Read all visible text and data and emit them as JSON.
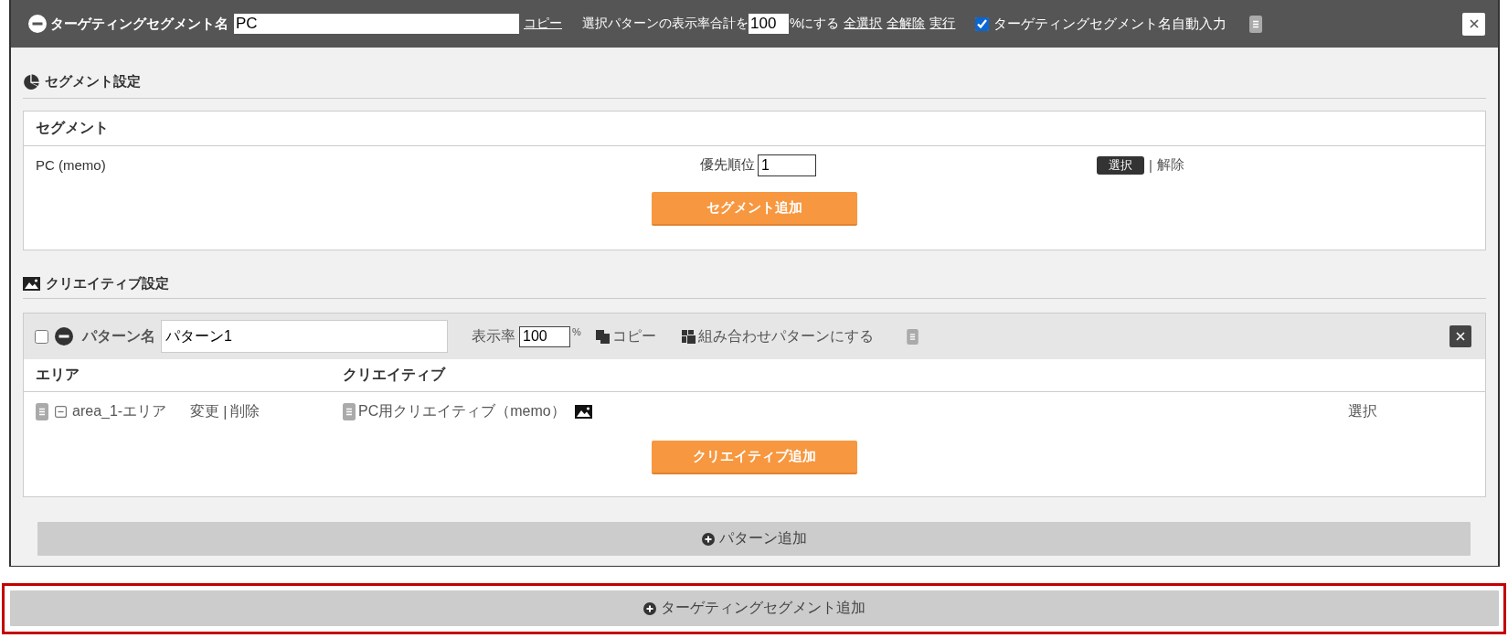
{
  "top_bar": {
    "title": "ターゲティングセグメント名",
    "segment_name": "PC",
    "copy_link": "コピー",
    "rate_prefix": "選択パターンの表示率合計を",
    "rate_value": "100",
    "rate_suffix": "%にする",
    "links": [
      "全選択",
      "全解除",
      "実行"
    ],
    "auto_name": {
      "label": "ターゲティングセグメント名自動入力",
      "checked": true
    }
  },
  "segment_settings": {
    "title": "セグメント設定",
    "table_title": "セグメント",
    "rows": [
      {
        "name": "PC (memo)",
        "priority_label": "優先順位",
        "priority": "1",
        "select_button": "選択",
        "separator": "|",
        "remove_link": "解除"
      }
    ],
    "add_button": "セグメント追加"
  },
  "creative_settings": {
    "title": "クリエイティブ設定",
    "patterns": [
      {
        "checked": false,
        "name_label": "パターン名",
        "name": "パターン1",
        "rate_label": "表示率",
        "rate": "100",
        "rate_unit": "%",
        "copy_action": "コピー",
        "combine_action": "組み合わせパターンにする",
        "columns": [
          "エリア",
          "クリエイティブ"
        ],
        "rows": [
          {
            "area": "area_1-エリア",
            "change_link": "変更",
            "separator": "|",
            "delete_link": "削除",
            "creative": "PC用クリエイティブ（memo）",
            "select_link": "選択"
          }
        ],
        "add_button": "クリエイティブ追加"
      }
    ],
    "add_pattern_button": "パターン追加"
  },
  "add_segment": {
    "label": "ターゲティングセグメント追加",
    "highlighted": true
  }
}
